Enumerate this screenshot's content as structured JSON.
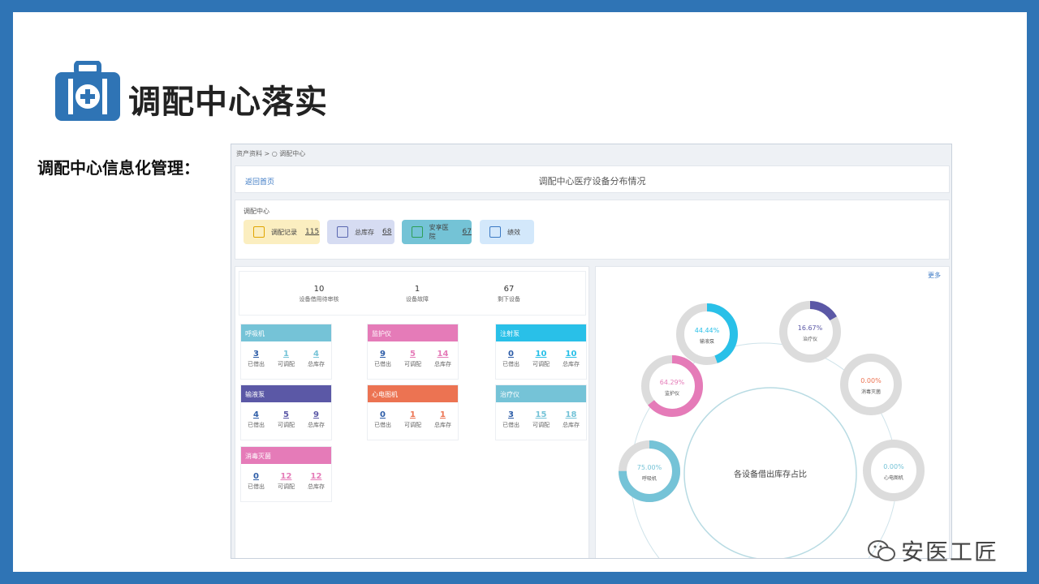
{
  "slide": {
    "headline": "调配中心落实",
    "subhead": "调配中心信息化管理：",
    "watermark": "安医工匠"
  },
  "screen": {
    "breadcrumb": "资产资料 > ○ 调配中心",
    "back_link": "返回首页",
    "page_title": "调配中心医疗设备分布情况",
    "center_label": "调配中心",
    "tiles": [
      {
        "label": "调配记录",
        "value": "115",
        "bg": "#fbeec0",
        "icon": "arrow-back-icon",
        "iconColor": "#e0a500"
      },
      {
        "label": "总库存",
        "value": "68",
        "bg": "#d6dcf2",
        "icon": "building-icon",
        "iconColor": "#5a67b0"
      },
      {
        "label": "安享医院",
        "value": "67",
        "bg": "#74c3d6",
        "icon": "hospital-icon",
        "iconColor": "#2e9e55"
      },
      {
        "label": "绩效",
        "value": "",
        "bg": "#d3e8fb",
        "icon": "chart-icon",
        "iconColor": "#3c7ac4"
      }
    ],
    "stats": [
      {
        "value": "10",
        "label": "设备借用待审核"
      },
      {
        "value": "1",
        "label": "设备故障"
      },
      {
        "value": "67",
        "label": "剩下设备"
      }
    ],
    "col_labels": [
      "已借出",
      "可调配",
      "总库存"
    ],
    "devices": [
      {
        "name": "呼吸机",
        "color": "#75c3d7",
        "lent": "3",
        "avail": "1",
        "total": "4"
      },
      {
        "name": "监护仪",
        "color": "#e57bb8",
        "lent": "9",
        "avail": "5",
        "total": "14"
      },
      {
        "name": "注射泵",
        "color": "#29c0e8",
        "lent": "0",
        "avail": "10",
        "total": "10"
      },
      {
        "name": "输液泵",
        "color": "#5b58a6",
        "lent": "4",
        "avail": "5",
        "total": "9"
      },
      {
        "name": "心电图机",
        "color": "#ec7352",
        "lent": "0",
        "avail": "1",
        "total": "1"
      },
      {
        "name": "治疗仪",
        "color": "#75c3d7",
        "lent": "3",
        "avail": "15",
        "total": "18"
      },
      {
        "name": "消毒灭菌",
        "color": "#e57bb8",
        "lent": "0",
        "avail": "12",
        "total": "12"
      }
    ],
    "more_link": "更多",
    "ring_center_label": "各设备借出库存占比",
    "rings": [
      {
        "pct": "75.00%",
        "name": "呼吸机",
        "frac": 0.75,
        "color": "#75c3d7"
      },
      {
        "pct": "64.29%",
        "name": "监护仪",
        "frac": 0.6429,
        "color": "#e57bb8"
      },
      {
        "pct": "44.44%",
        "name": "输液泵",
        "frac": 0.4444,
        "color": "#29c0e8"
      },
      {
        "pct": "16.67%",
        "name": "治疗仪",
        "frac": 0.1667,
        "color": "#5b58a6"
      },
      {
        "pct": "0.00%",
        "name": "消毒灭菌",
        "frac": 0,
        "color": "#ec7352"
      },
      {
        "pct": "0.00%",
        "name": "心电图机",
        "frac": 0,
        "color": "#75c3d7"
      }
    ]
  }
}
